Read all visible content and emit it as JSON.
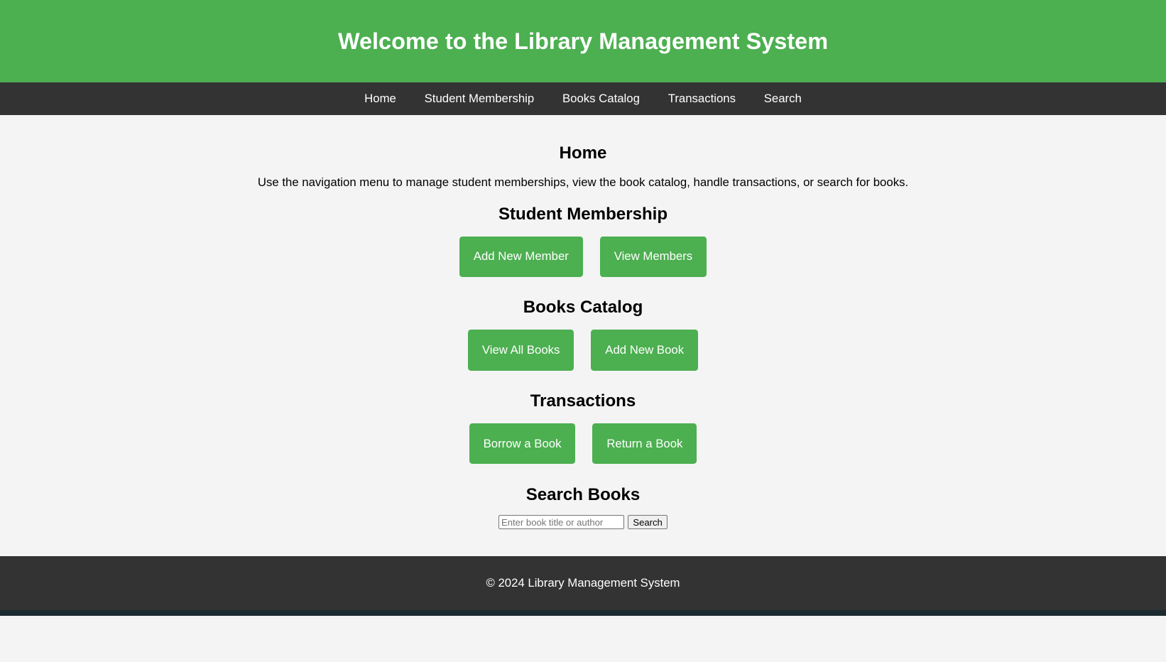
{
  "header": {
    "title": "Welcome to the Library Management System"
  },
  "nav": {
    "items": [
      "Home",
      "Student Membership",
      "Books Catalog",
      "Transactions",
      "Search"
    ]
  },
  "home": {
    "title": "Home",
    "text": "Use the navigation menu to manage student memberships, view the book catalog, handle transactions, or search for books."
  },
  "membership": {
    "title": "Student Membership",
    "buttons": [
      "Add New Member",
      "View Members"
    ]
  },
  "catalog": {
    "title": "Books Catalog",
    "buttons": [
      "View All Books",
      "Add New Book"
    ]
  },
  "transactions": {
    "title": "Transactions",
    "buttons": [
      "Borrow a Book",
      "Return a Book"
    ]
  },
  "search": {
    "title": "Search Books",
    "placeholder": "Enter book title or author",
    "value": "",
    "button": "Search"
  },
  "footer": {
    "text": "© 2024 Library Management System"
  },
  "colors": {
    "accent": "#4caf50",
    "nav": "#333333",
    "background": "#f4f4f4"
  }
}
